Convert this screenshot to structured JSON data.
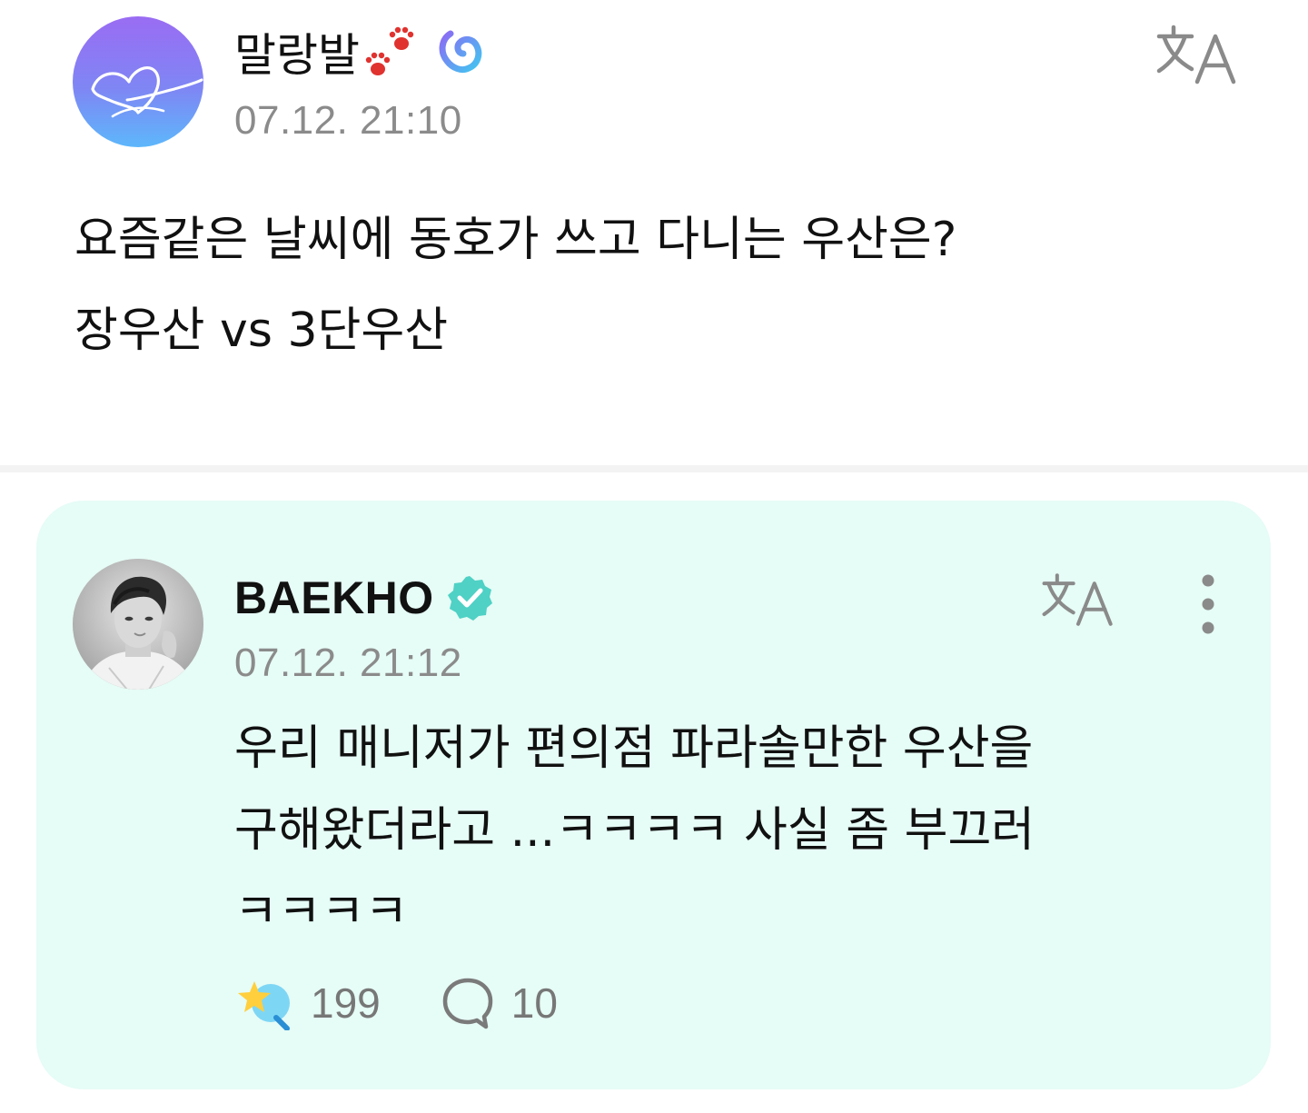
{
  "post": {
    "author": "말랑발",
    "timestamp": "07.12. 21:10",
    "body": "요즘같은 날씨에 동호가 쓰고 다니는 우산은?\n장우산 vs 3단우산",
    "icons": {
      "avatar": "heart-avatar-icon",
      "decoration": "paw-prints-icon",
      "badge": "weverse-membership-icon",
      "translate": "translate-icon"
    }
  },
  "reply": {
    "author": "BAEKHO",
    "timestamp": "07.12. 21:12",
    "body": "우리 매니저가 편의점 파라솔만한 우산을\n구해왔더라고 ...ㅋㅋㅋㅋ 사실 좀 부끄러\nㅋㅋㅋㅋ",
    "like_count": "199",
    "comment_count": "10",
    "icons": {
      "verified": "verified-check-icon",
      "translate": "translate-icon",
      "more": "more-vertical-icon",
      "like": "star-like-icon",
      "comment": "comment-bubble-icon"
    }
  },
  "colors": {
    "card_background": "#e6fcf6",
    "verified": "#4fd1c5",
    "timestamp": "#8b8b8b",
    "icon_gray": "#8a8a8a"
  }
}
